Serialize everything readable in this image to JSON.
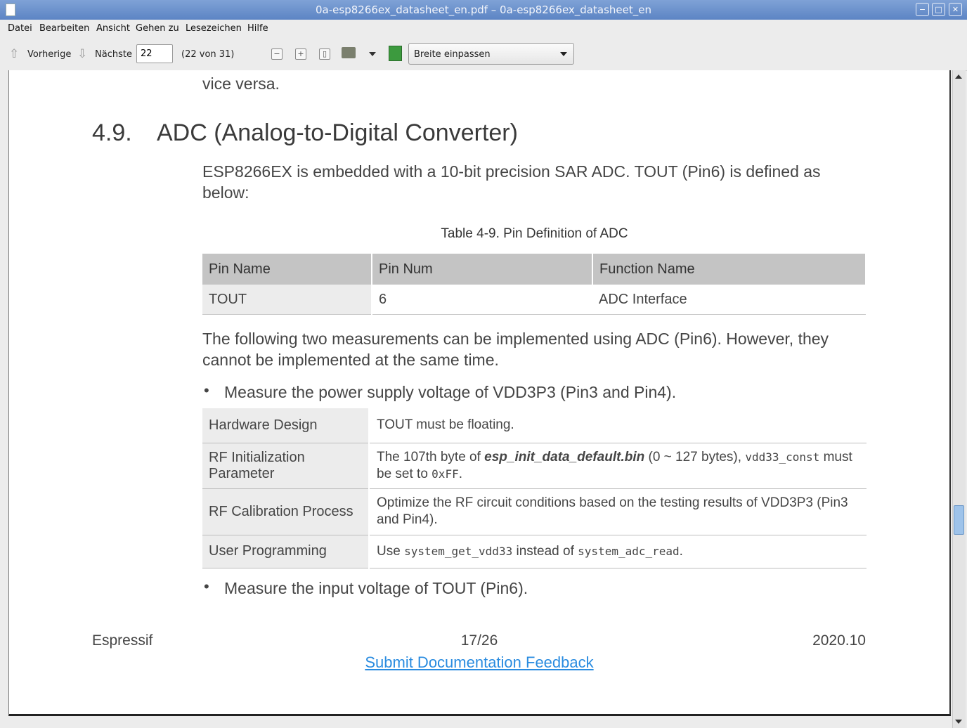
{
  "window": {
    "title": "0a-esp8266ex_datasheet_en.pdf – 0a-esp8266ex_datasheet_en",
    "minimize": "−",
    "maximize": "□",
    "close": "✕"
  },
  "menu": [
    "Datei",
    "Bearbeiten",
    "Ansicht",
    "Gehen zu",
    "Lesezeichen",
    "Hilfe"
  ],
  "toolbar": {
    "prev_label": "Vorherige",
    "next_label": "Nächste",
    "page_value": "22",
    "page_count": "(22 von 31)",
    "zoom_value": "Breite einpassen",
    "zoom_out": "−",
    "zoom_in": "+",
    "page_icon": "▯"
  },
  "document": {
    "prev_text": "vice versa.",
    "section_number": "4.9.",
    "section_title": "ADC (Analog-to-Digital Converter)",
    "intro_line1": "ESP8266EX is embedded with a 10-bit precision SAR ADC. TOUT (Pin6) is defined as",
    "intro_line2": "below:",
    "table_caption": "Table 4-9. Pin Definition of ADC",
    "pin_table": {
      "headers": [
        "Pin Name",
        "Pin Num",
        "Function Name"
      ],
      "rows": [
        [
          "TOUT",
          "6",
          "ADC Interface"
        ]
      ]
    },
    "para_line1": "The following two measurements can be implemented using ADC (Pin6). However, they",
    "para_line2": "cannot be implemented at the same time.",
    "bullet1": "Measure the power supply voltage of VDD3P3 (Pin3 and Pin4).",
    "measure_table": [
      {
        "key": "Hardware Design",
        "value": "TOUT must be floating."
      },
      {
        "key": "RF Initialization Parameter",
        "value_pre": "The 107th byte of ",
        "value_file": "esp_init_data_default.bin",
        "value_mid": " (0 ~ 127 bytes), ",
        "value_code1": "vdd33_const",
        "value_mid2": " must be set to ",
        "value_code2": "0xFF",
        "value_end": "."
      },
      {
        "key": "RF Calibration Process",
        "value": "Optimize the RF circuit conditions based on the testing results of VDD3P3 (Pin3 and Pin4)."
      },
      {
        "key": "User Programming",
        "value_pre": "Use ",
        "value_code1": "system_get_vdd33",
        "value_mid": " instead of ",
        "value_code2": "system_adc_read",
        "value_end": "."
      }
    ],
    "bullet2": "Measure the input voltage of TOUT (Pin6).",
    "bullet_symbol": "•",
    "footer": {
      "left": "Espressif",
      "center": "17/26",
      "right": "2020.10",
      "link": "Submit Documentation Feedback"
    }
  }
}
